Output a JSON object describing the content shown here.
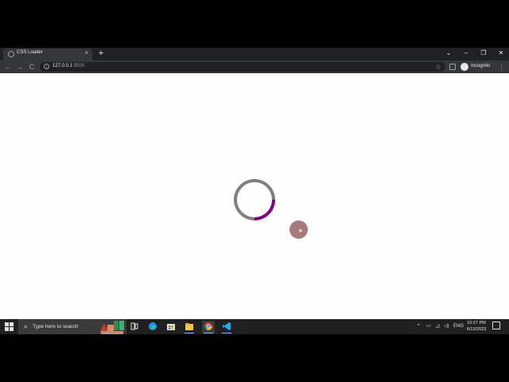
{
  "browser": {
    "tab_title": "CSS Loader",
    "tab_close": "×",
    "new_tab": "+",
    "url_host": "127.0.0.1",
    "url_port": ":5500",
    "profile_label": "Incognito",
    "window_controls": [
      "⌄",
      "–",
      "❐",
      "✕"
    ]
  },
  "nav": {
    "back": "←",
    "forward": "→",
    "reload": "C",
    "info": "i",
    "star": "☆",
    "menu": "⋮"
  },
  "loader": {
    "track_color": "#7f7f7f",
    "arc_color": "#800080"
  },
  "taskbar": {
    "search_placeholder": "Type here to search",
    "search_glyph": "⌕",
    "lang": "ENG",
    "time": "10:27 PM",
    "date": "6/13/2023",
    "tray_up": "^",
    "icons": [
      "task-view-icon",
      "edge-icon",
      "store-icon",
      "file-explorer-icon",
      "chrome-icon",
      "vscode-icon"
    ]
  }
}
